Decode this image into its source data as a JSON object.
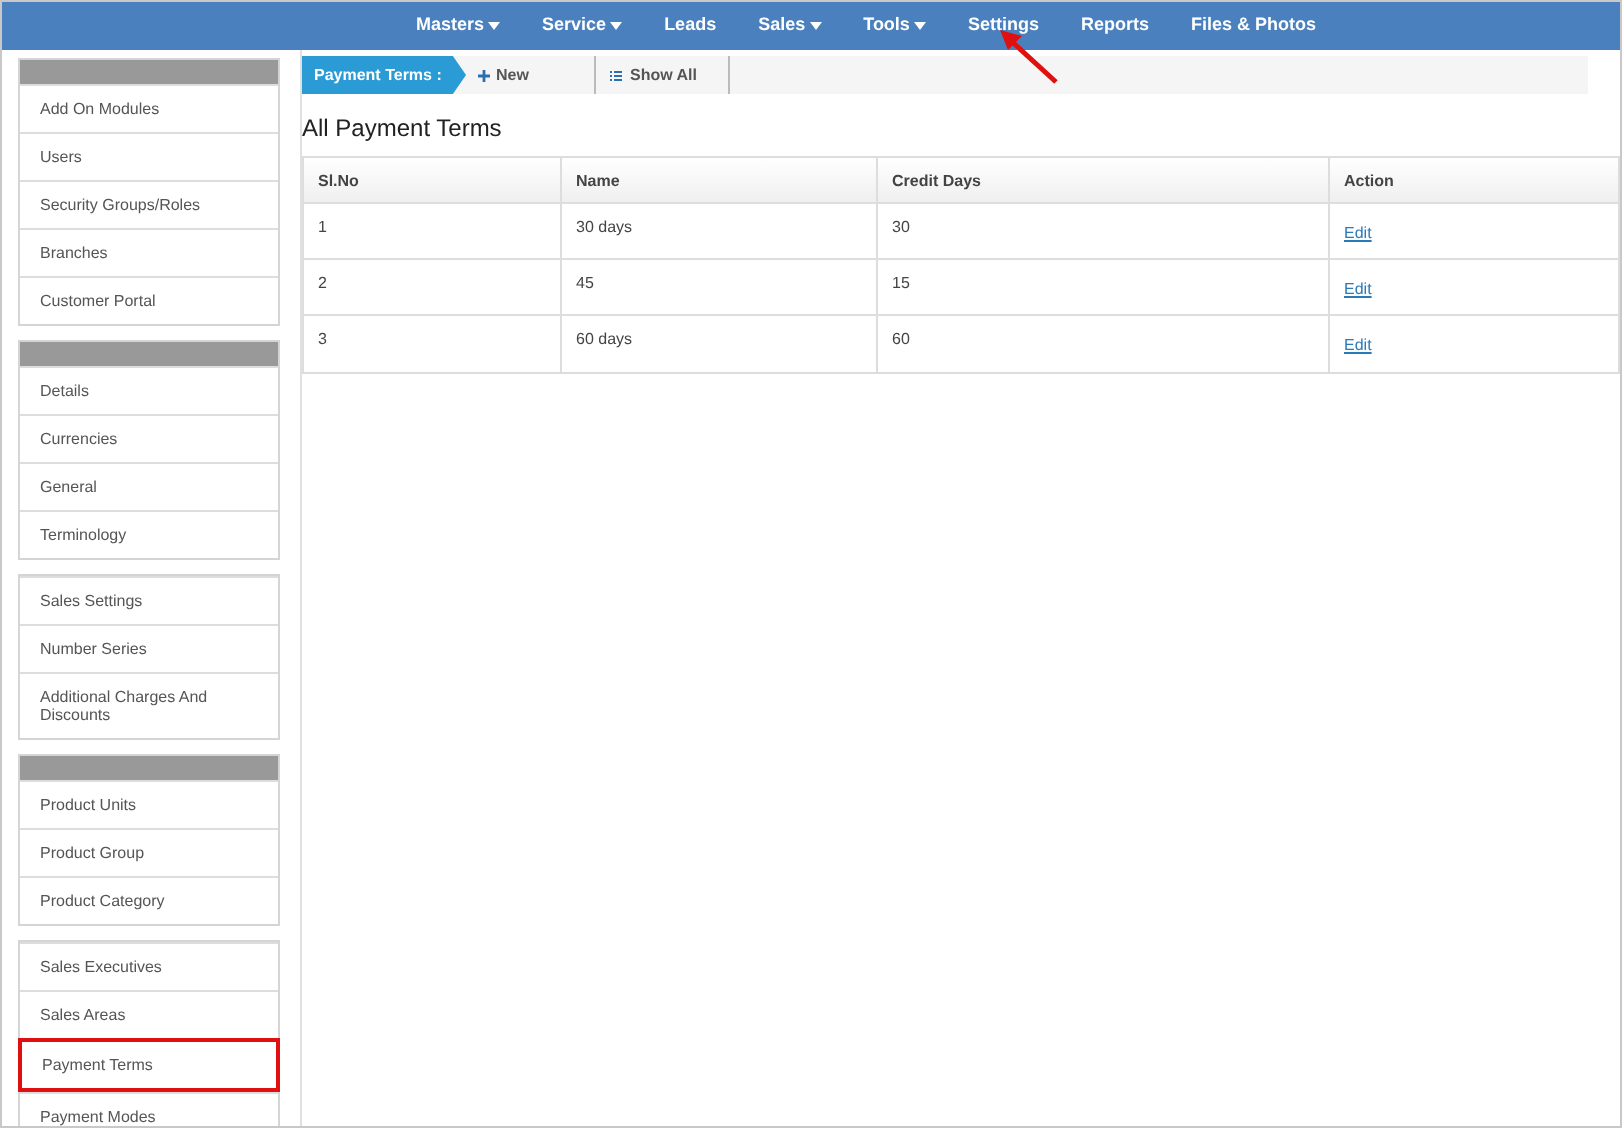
{
  "nav": [
    {
      "label": "Masters",
      "dropdown": true,
      "selected": false
    },
    {
      "label": "Service",
      "dropdown": true,
      "selected": false
    },
    {
      "label": "Leads",
      "dropdown": false,
      "selected": false
    },
    {
      "label": "Sales",
      "dropdown": true,
      "selected": false
    },
    {
      "label": "Tools",
      "dropdown": true,
      "selected": false
    },
    {
      "label": "Settings",
      "dropdown": false,
      "selected": true
    },
    {
      "label": "Reports",
      "dropdown": false,
      "selected": false
    },
    {
      "label": "Files & Photos",
      "dropdown": false,
      "selected": false
    }
  ],
  "sidebar": {
    "groups": [
      {
        "header": true,
        "items": [
          {
            "label": "Add On Modules",
            "highlighted": false
          },
          {
            "label": "Users",
            "highlighted": false
          },
          {
            "label": "Security Groups/Roles",
            "highlighted": false
          },
          {
            "label": "Branches",
            "highlighted": false
          },
          {
            "label": "Customer Portal",
            "highlighted": false
          }
        ]
      },
      {
        "header": true,
        "items": [
          {
            "label": "Details",
            "highlighted": false
          },
          {
            "label": "Currencies",
            "highlighted": false
          },
          {
            "label": "General",
            "highlighted": false
          },
          {
            "label": "Terminology",
            "highlighted": false
          }
        ]
      },
      {
        "header": false,
        "items": [
          {
            "label": "Sales Settings",
            "highlighted": false
          },
          {
            "label": "Number Series",
            "highlighted": false
          },
          {
            "label": "Additional Charges And Discounts",
            "highlighted": false
          }
        ]
      },
      {
        "header": true,
        "items": [
          {
            "label": "Product Units",
            "highlighted": false
          },
          {
            "label": "Product Group",
            "highlighted": false
          },
          {
            "label": "Product Category",
            "highlighted": false
          }
        ]
      },
      {
        "header": false,
        "items": [
          {
            "label": "Sales Executives",
            "highlighted": false
          },
          {
            "label": "Sales Areas",
            "highlighted": false
          },
          {
            "label": "Payment Terms",
            "highlighted": true
          },
          {
            "label": "Payment Modes",
            "highlighted": false
          }
        ]
      }
    ]
  },
  "toolbar": {
    "section": "Payment Terms :",
    "new": "New",
    "show_all": "Show All"
  },
  "title": "All Payment Terms",
  "table": {
    "columns": [
      "Sl.No",
      "Name",
      "Credit Days",
      "Action"
    ],
    "rows": [
      [
        "1",
        "30 days",
        "30",
        "Edit"
      ],
      [
        "2",
        "45",
        "15",
        "Edit"
      ],
      [
        "3",
        "60 days",
        "60",
        "Edit"
      ]
    ]
  }
}
